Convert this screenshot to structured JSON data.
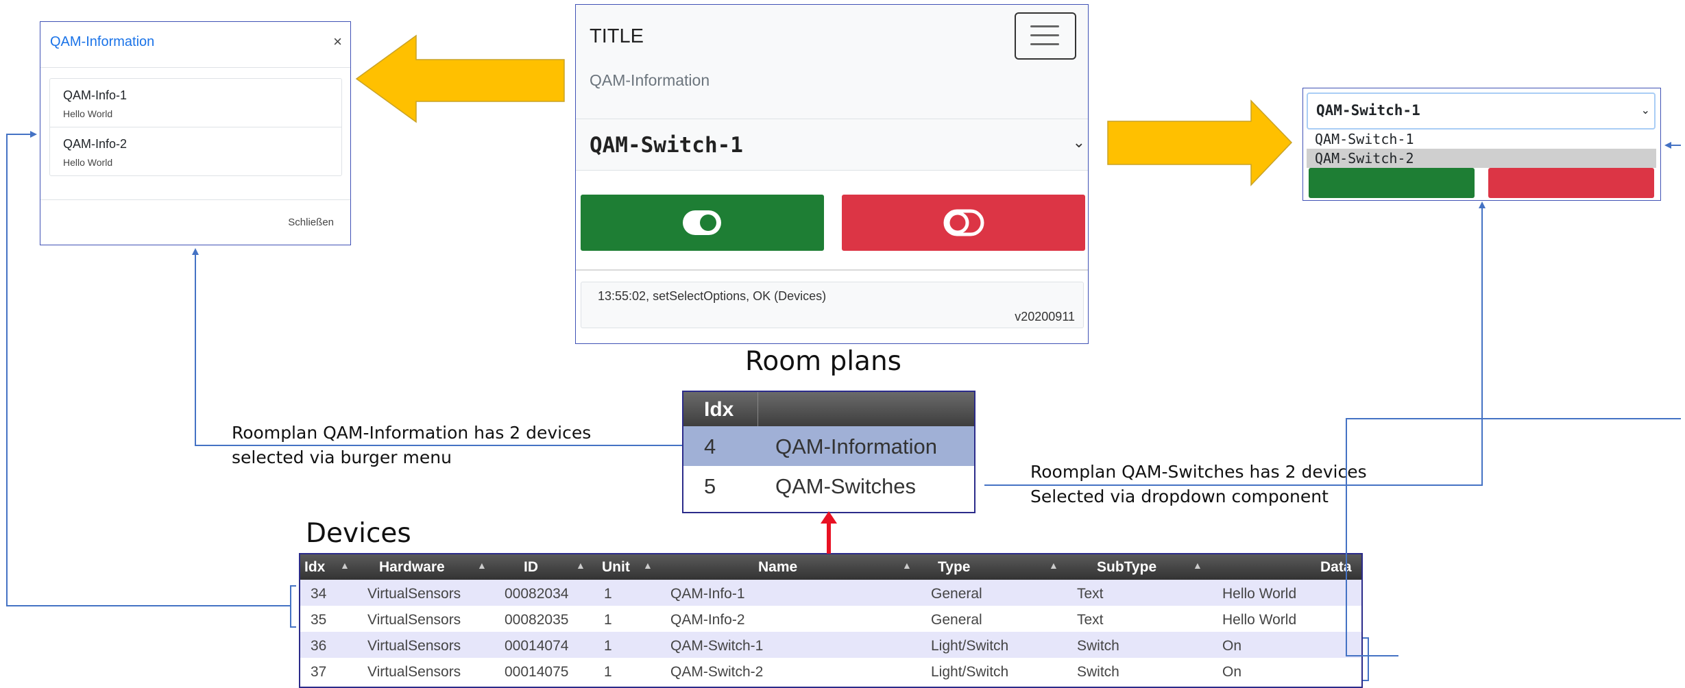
{
  "modal": {
    "title": "QAM-Information",
    "close": "×",
    "items": [
      {
        "title": "QAM-Info-1",
        "sub": "Hello World"
      },
      {
        "title": "QAM-Info-2",
        "sub": "Hello World"
      }
    ],
    "footer": "Schließen"
  },
  "phone": {
    "brand": "TITLE",
    "subtitle": "QAM-Information",
    "selected": "QAM-Switch-1",
    "status": "13:55:02, setSelectOptions, OK (Devices)",
    "version": "v20200911"
  },
  "dropdown": {
    "selected": "QAM-Switch-1",
    "options": [
      "QAM-Switch-1",
      "QAM-Switch-2"
    ]
  },
  "headings": {
    "roomplans": "Room plans",
    "devices": "Devices"
  },
  "notes": {
    "left_line1": "Roomplan QAM-Information has 2 devices",
    "left_line2": "selected via burger menu",
    "right_line1": "Roomplan QAM-Switches has 2 devices",
    "right_line2": "Selected via dropdown component"
  },
  "roomplans": {
    "header": "Idx",
    "rows": [
      {
        "idx": "4",
        "name": "QAM-Information"
      },
      {
        "idx": "5",
        "name": "QAM-Switches"
      }
    ]
  },
  "devices": {
    "columns": [
      "Idx",
      "Hardware",
      "ID",
      "Unit",
      "Name",
      "Type",
      "SubType",
      "Data"
    ],
    "rows": [
      {
        "idx": "34",
        "hardware": "VirtualSensors",
        "id": "00082034",
        "unit": "1",
        "name": "QAM-Info-1",
        "type": "General",
        "subtype": "Text",
        "data": "Hello World"
      },
      {
        "idx": "35",
        "hardware": "VirtualSensors",
        "id": "00082035",
        "unit": "1",
        "name": "QAM-Info-2",
        "type": "General",
        "subtype": "Text",
        "data": "Hello World"
      },
      {
        "idx": "36",
        "hardware": "VirtualSensors",
        "id": "00014074",
        "unit": "1",
        "name": "QAM-Switch-1",
        "type": "Light/Switch",
        "subtype": "Switch",
        "data": "On"
      },
      {
        "idx": "37",
        "hardware": "VirtualSensors",
        "id": "00014075",
        "unit": "1",
        "name": "QAM-Switch-2",
        "type": "Light/Switch",
        "subtype": "Switch",
        "data": "On"
      }
    ]
  },
  "colors": {
    "arrow_fill": "#ffc000",
    "connector": "#4472c4",
    "accent_red": "#e81123"
  }
}
